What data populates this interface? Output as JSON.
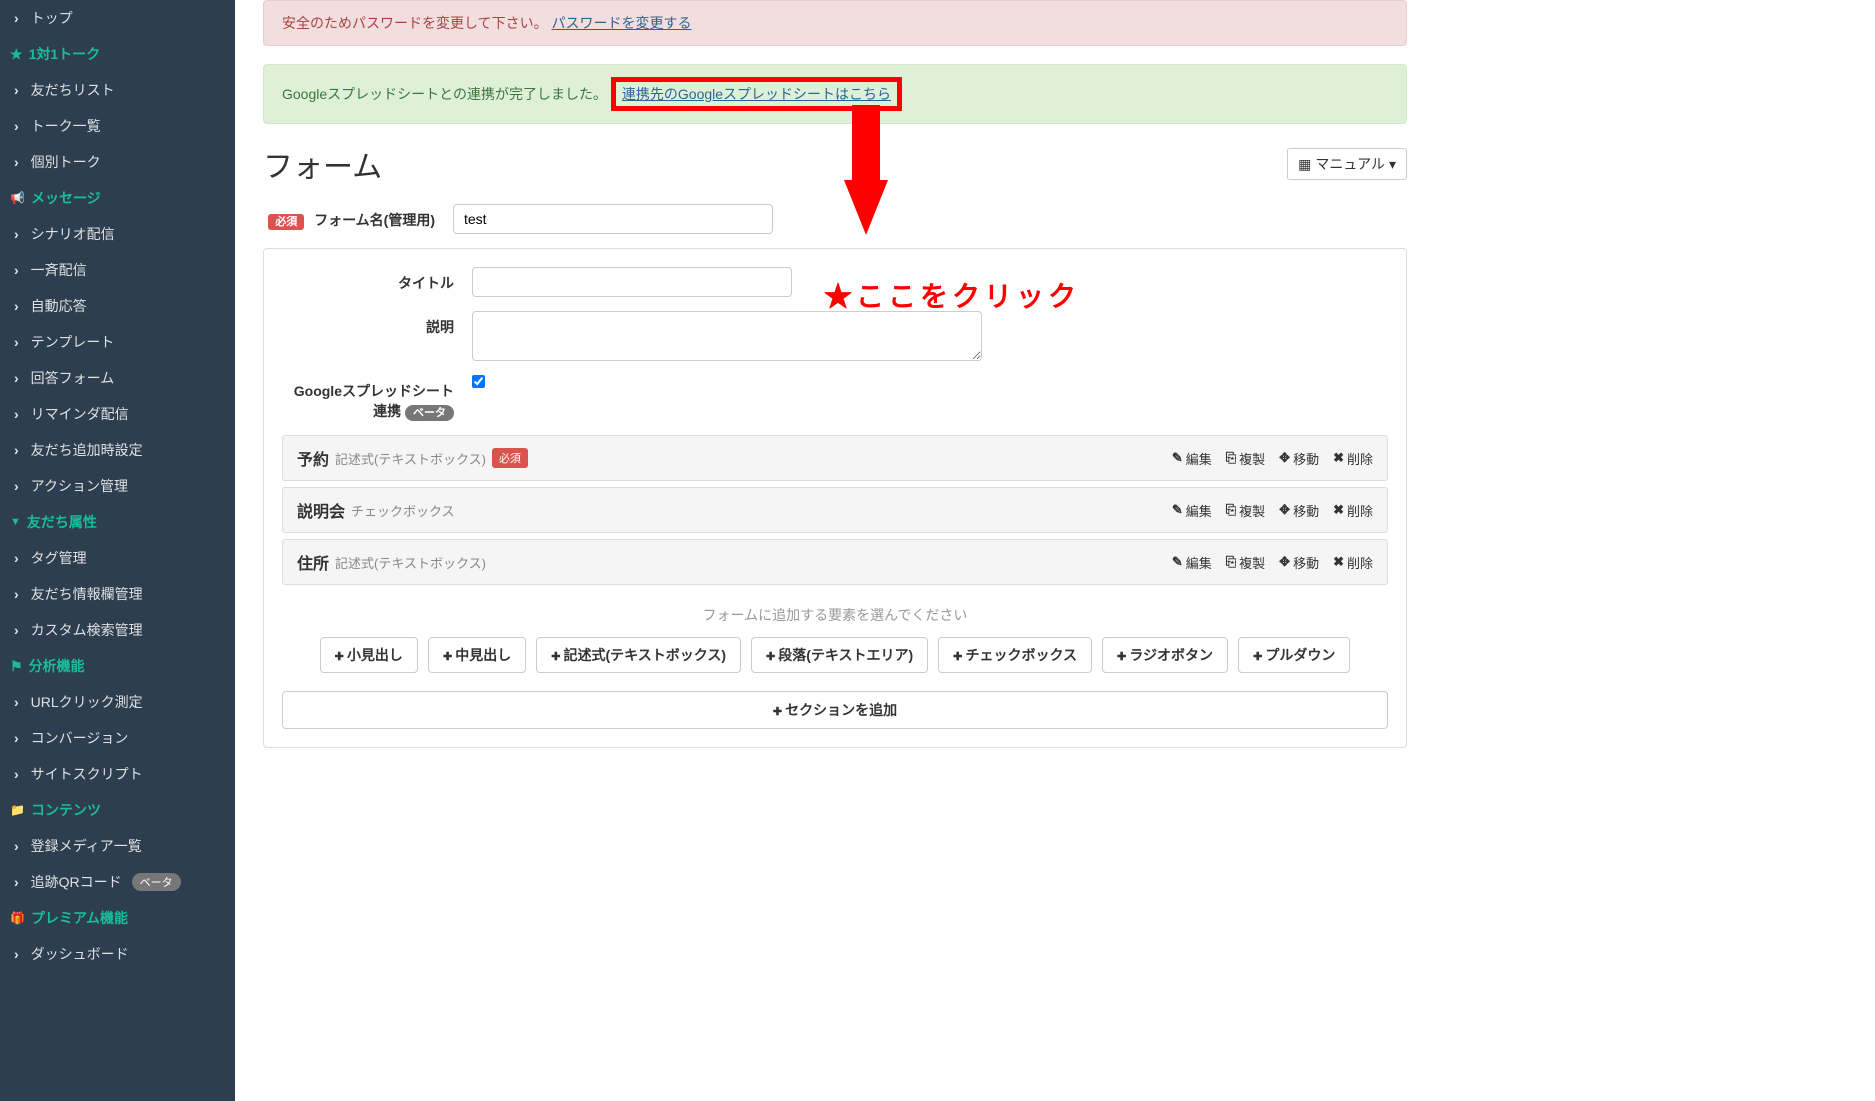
{
  "sidebar": {
    "top": "トップ",
    "s1": {
      "header": "1対1トーク",
      "items": [
        "友だちリスト",
        "トーク一覧",
        "個別トーク"
      ]
    },
    "s2": {
      "header": "メッセージ",
      "items": [
        "シナリオ配信",
        "一斉配信",
        "自動応答",
        "テンプレート",
        "回答フォーム",
        "リマインダ配信",
        "友だち追加時設定",
        "アクション管理"
      ]
    },
    "s3": {
      "header": "友だち属性",
      "items": [
        "タグ管理",
        "友だち情報欄管理",
        "カスタム検索管理"
      ]
    },
    "s4": {
      "header": "分析機能",
      "items": [
        "URLクリック測定",
        "コンバージョン",
        "サイトスクリプト"
      ]
    },
    "s5": {
      "header": "コンテンツ",
      "items": [
        "登録メディア一覧",
        "追跡QRコード"
      ]
    },
    "s5_beta": "ベータ",
    "s6": {
      "header": "プレミアム機能",
      "items": [
        "ダッシュボード"
      ]
    }
  },
  "alert_warn": {
    "text": "安全のためパスワードを変更して下さい。",
    "link": "パスワードを変更する"
  },
  "alert_ok": {
    "text": "Googleスプレッドシートとの連携が完了しました。",
    "link": "連携先のGoogleスプレッドシートはこちら"
  },
  "annotation": "★ここをクリック",
  "page": {
    "title": "フォーム",
    "manual": "マニュアル"
  },
  "form_name": {
    "required": "必須",
    "label": "フォーム名(管理用)",
    "value": "test"
  },
  "fields": {
    "title_label": "タイトル",
    "desc_label": "説明",
    "gsheet_label": "Googleスプレッドシート連携",
    "gsheet_beta": "ベータ",
    "gsheet_checked": true
  },
  "rows": [
    {
      "name": "予約",
      "type": "記述式(テキストボックス)",
      "required": "必須"
    },
    {
      "name": "説明会",
      "type": "チェックボックス",
      "required": null
    },
    {
      "name": "住所",
      "type": "記述式(テキストボックス)",
      "required": null
    }
  ],
  "actions": {
    "edit": "編集",
    "copy": "複製",
    "move": "移動",
    "delete": "削除"
  },
  "add": {
    "prompt": "フォームに追加する要素を選んでください",
    "buttons": [
      "小見出し",
      "中見出し",
      "記述式(テキストボックス)",
      "段落(テキストエリア)",
      "チェックボックス",
      "ラジオボタン",
      "プルダウン"
    ]
  },
  "section_btn": "セクションを追加"
}
